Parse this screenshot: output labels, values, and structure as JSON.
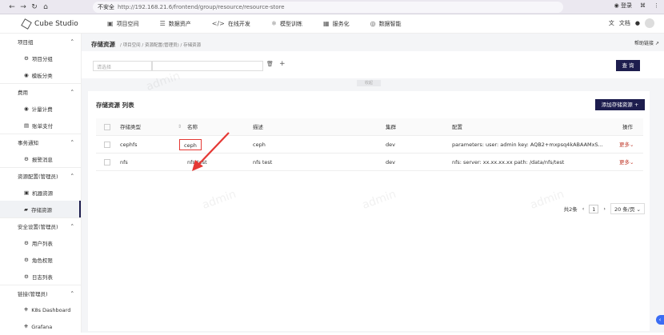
{
  "browser": {
    "security": "不安全",
    "url": "http://192.168.21.6/frontend/group/resource/resource-store",
    "login": "登录"
  },
  "topnav": {
    "logo": "Cube Studio",
    "items": [
      {
        "label": "项目空间",
        "icon": "briefcase-icon"
      },
      {
        "label": "数据资产",
        "icon": "database-icon"
      },
      {
        "label": "在线开发",
        "icon": "code-icon"
      },
      {
        "label": "模型训练",
        "icon": "network-icon"
      },
      {
        "label": "服务化",
        "icon": "server-icon"
      },
      {
        "label": "数据智能",
        "icon": "brain-icon"
      }
    ],
    "docs": "文档"
  },
  "sidebar": {
    "groups": [
      {
        "label": "项目组",
        "items": [
          {
            "label": "项目分组",
            "icon": "group-icon"
          },
          {
            "label": "模板分类",
            "icon": "template-icon"
          }
        ]
      },
      {
        "label": "费用",
        "items": [
          {
            "label": "计量计费",
            "icon": "meter-icon"
          },
          {
            "label": "账单支付",
            "icon": "bill-icon"
          }
        ]
      },
      {
        "label": "事务通知",
        "items": [
          {
            "label": "报警消息",
            "icon": "alert-icon"
          }
        ]
      },
      {
        "label": "资源配置(管理员)",
        "items": [
          {
            "label": "机器资源",
            "icon": "machine-icon"
          },
          {
            "label": "存储资源",
            "icon": "storage-icon"
          }
        ]
      },
      {
        "label": "安全设置(管理员)",
        "items": [
          {
            "label": "用户列表",
            "icon": "user-icon"
          },
          {
            "label": "角色权限",
            "icon": "role-icon"
          },
          {
            "label": "日志列表",
            "icon": "log-icon"
          }
        ]
      },
      {
        "label": "链接(管理员)",
        "items": [
          {
            "label": "K8s Dashboard",
            "icon": "k8s-icon"
          },
          {
            "label": "Grafana",
            "icon": "grafana-icon"
          }
        ]
      }
    ]
  },
  "page": {
    "title": "存储资源",
    "breadcrumb": "/ 项目空间 / 资源配置(管理员) / 存储资源",
    "help": "帮助链接",
    "filter_placeholder": "请选择",
    "query": "查 询",
    "collapse": "收起",
    "list_title": "存储资源 列表",
    "add_button": "添加存储资源",
    "columns": [
      "存储类型",
      "名称",
      "描述",
      "集群",
      "配置",
      "操作"
    ],
    "rows": [
      {
        "type": "cephfs",
        "name": "ceph",
        "desc": "ceph",
        "cluster": "dev",
        "config": "parameters: user: admin key: AQB2+mxpsq4kABAAMxS...",
        "action": "更多"
      },
      {
        "type": "nfs",
        "name": "nfs-test",
        "desc": "nfs test",
        "cluster": "dev",
        "config": "nfs: server: xx.xx.xx.xx path: /data/nfs/test",
        "action": "更多"
      }
    ],
    "total": "共2条",
    "page_no": "1",
    "page_size": "20 条/页"
  },
  "watermark": "admin"
}
